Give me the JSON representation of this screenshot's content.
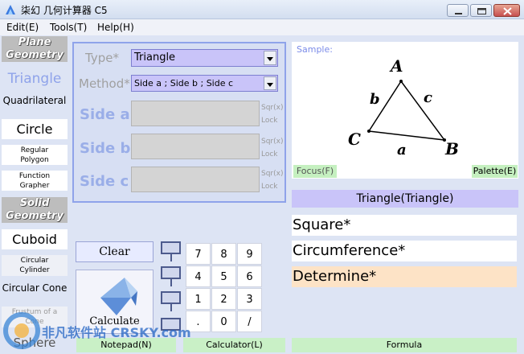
{
  "window": {
    "title": "柒幻 几何计算器 C5"
  },
  "menu": [
    {
      "label": "Edit(E)"
    },
    {
      "label": "Tools(T)"
    },
    {
      "label": "Help(H)"
    }
  ],
  "sidebar": {
    "plane_header": [
      "Plane",
      "Geometry"
    ],
    "solid_header": [
      "Solid",
      "Geometry"
    ],
    "items": {
      "triangle": "Triangle",
      "quadrilateral": "Quadrilateral",
      "circle": "Circle",
      "regular_polygon": [
        "Regular",
        "Polygon"
      ],
      "function_grapher": [
        "Function",
        "Grapher"
      ],
      "cuboid": "Cuboid",
      "circular_cylinder": [
        "Circular",
        "Cylinder"
      ],
      "circular_cone": "Circular Cone",
      "frustum": [
        "Frustum of a",
        "Cone"
      ],
      "sphere": "Sphere"
    }
  },
  "form": {
    "type_label": "Type*",
    "type_value": "Triangle",
    "method_label": "Method*",
    "method_value": "Side a ; Side b ; Side c",
    "fields": [
      {
        "label": "Side a",
        "sqr": "Sqr(x)",
        "lock": "Lock",
        "value": ""
      },
      {
        "label": "Side b",
        "sqr": "Sqr(x)",
        "lock": "Lock",
        "value": ""
      },
      {
        "label": "Side c",
        "sqr": "Sqr(x)",
        "lock": "Lock",
        "value": ""
      }
    ]
  },
  "sample": {
    "label": "Sample:",
    "vertex_a": "A",
    "vertex_b": "B",
    "vertex_c": "C",
    "side_a": "a",
    "side_b": "b",
    "side_c": "c",
    "focus_label": "Focus(F)",
    "palette_label": "Palette(E)"
  },
  "shape_title": "Triangle(Triangle)",
  "results": [
    "Square*",
    "Circumference*",
    "Determine*"
  ],
  "results_colors": [
    "#ffffff",
    "#ffffff",
    "#fde3c6"
  ],
  "buttons": {
    "clear": "Clear",
    "calculate": "Calculate"
  },
  "keypad": [
    [
      "7",
      "8",
      "9"
    ],
    [
      "4",
      "5",
      "6"
    ],
    [
      "1",
      "2",
      "3"
    ],
    [
      ".",
      "0",
      "/"
    ]
  ],
  "bottom": {
    "notepad": "Notepad(N)",
    "calculator": "Calculator(L)",
    "formula": "Formula"
  },
  "watermark": "非凡软件站 CRSKY.com",
  "colors": {
    "accent_lilac": "#c9c4f9",
    "green_button": "#c9f0c6",
    "panel_border": "#8fa3ea"
  }
}
